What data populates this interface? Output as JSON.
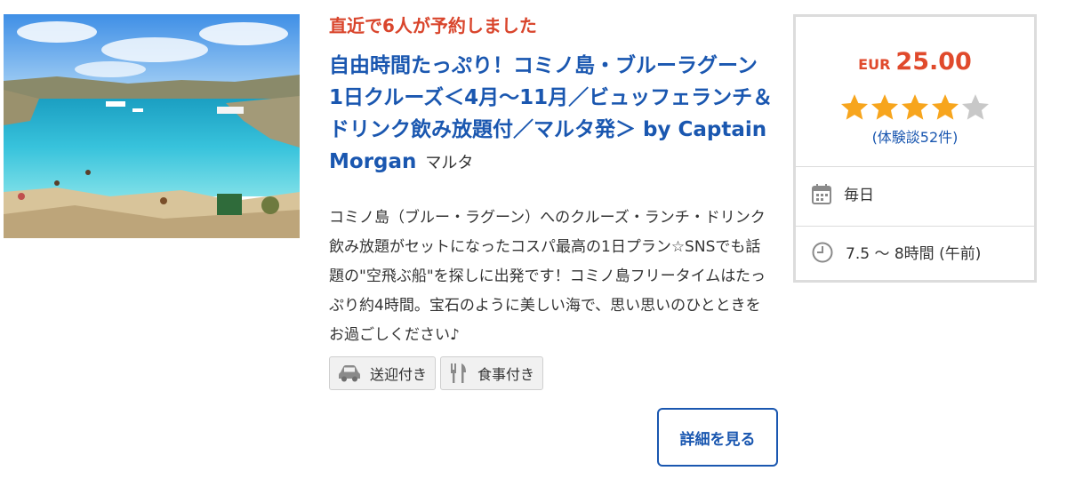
{
  "listing": {
    "image_alt": "",
    "recent_bookings": "直近で6人が予約しました",
    "title": "自由時間たっぷり！コミノ島・ブルーラグーン 1日クルーズ＜4月〜11月／ビュッフェランチ＆ドリンク飲み放題付／マルタ発＞ by Captain Morgan",
    "location": "マルタ",
    "description": "コミノ島（ブルー・ラグーン）へのクルーズ・ランチ・ドリンク飲み放題がセットになったコスパ最高の1日プラン☆SNSでも話題の\"空飛ぶ船\"を探しに出発です！コミノ島フリータイムはたっぷり約4時間。宝石のように美しい海で、思い思いのひとときをお過ごしください♪",
    "tags": [
      {
        "icon": "car-icon",
        "label": "送迎付き"
      },
      {
        "icon": "fork-knife-icon",
        "label": "食事付き"
      }
    ],
    "detail_button": "詳細を見る"
  },
  "sidebar": {
    "currency": "EUR",
    "price": "25.00",
    "rating": 4,
    "rating_max": 5,
    "reviews": "(体験談52件)",
    "schedule_icon": "calendar-icon",
    "schedule": "毎日",
    "duration_icon": "clock-icon",
    "duration": "7.5 〜 8時間 (午前)"
  },
  "colors": {
    "accent_blue": "#1a57b0",
    "alert_red": "#d9452c",
    "price_red": "#e04a2c",
    "star_filled": "#f7a51d",
    "star_empty": "#c8c8c8"
  }
}
